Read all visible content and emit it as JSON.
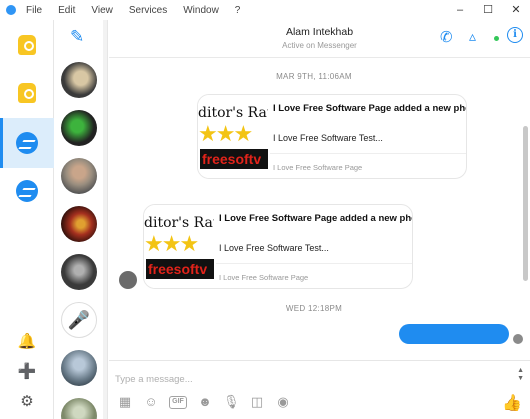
{
  "menubar": {
    "items": [
      "File",
      "Edit",
      "View",
      "Services",
      "Window",
      "?"
    ],
    "window_controls": [
      "–",
      "☐",
      "✕"
    ]
  },
  "header": {
    "contact_name": "Alam Intekhab",
    "contact_status": "Active on Messenger",
    "icons": [
      "phone-icon",
      "video-icon",
      "info-icon"
    ],
    "accent_color": "#1f8cf0"
  },
  "chat": {
    "timestamps": [
      "MAR 9TH, 11:06AM",
      "WED 12:18PM"
    ],
    "cards": [
      {
        "title": "I Love Free Software Page added a new photo.",
        "description": "I Love Free Software Test...",
        "source": "I Love Free Software Page",
        "thumb_rating_text": "ditor's Ratir",
        "thumb_brand_text": "freesoftv"
      },
      {
        "title": "I Love Free Software Page added a new photo.",
        "description": "I Love Free Software Test...",
        "source": "I Love Free Software Page",
        "thumb_rating_text": "ditor's Ratir",
        "thumb_brand_text": "freesoftv"
      }
    ]
  },
  "composer": {
    "placeholder": "Type a message...",
    "tools": [
      "photo-icon",
      "sticker-icon",
      "gif-icon",
      "emoji-icon",
      "mic-icon",
      "game-icon",
      "camera-icon"
    ],
    "gif_label": "GIF",
    "like_icon": "thumbs-up-icon"
  },
  "rail": {
    "icons": [
      "bulb-icon",
      "bulb-icon",
      "messenger-icon",
      "messenger-icon",
      "bell-icon",
      "plus-icon",
      "gear-icon"
    ]
  }
}
